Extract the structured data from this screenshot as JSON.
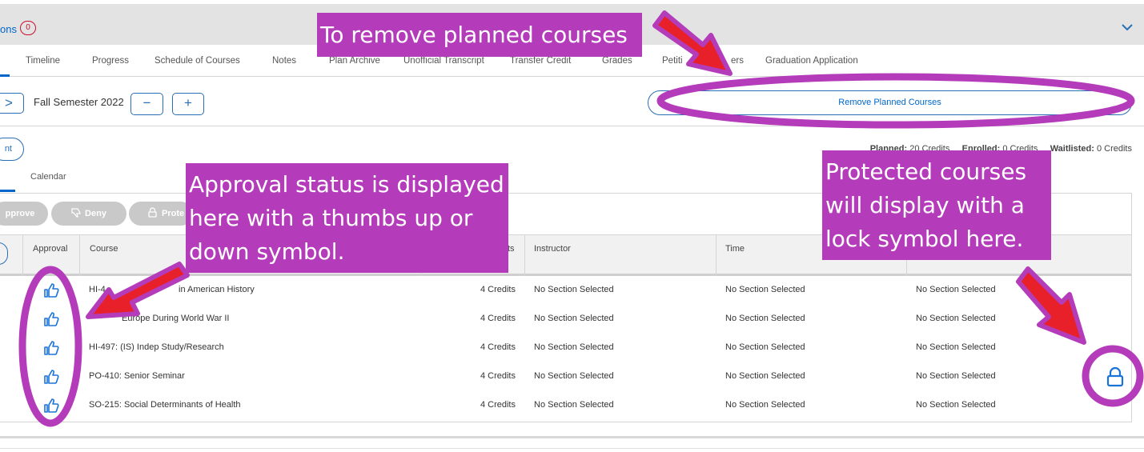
{
  "header": {
    "notifications_label": "ons",
    "notifications_count": "0"
  },
  "tabs": [
    "Timeline",
    "Progress",
    "Schedule of Courses",
    "Notes",
    "Plan Archive",
    "Unofficial Transcript",
    "Transfer Credit",
    "Grades",
    "Petiti",
    "ers",
    "Graduation Application"
  ],
  "term": {
    "label": "Fall Semester 2022",
    "next": ">",
    "minus": "−",
    "plus": "+"
  },
  "remove_button": "Remove Planned Courses",
  "left_pill": "nt",
  "credits": {
    "planned_label": "Planned:",
    "planned_value": "20 Credits",
    "enrolled_label": "Enrolled:",
    "enrolled_value": "0 Credits",
    "waitlisted_label": "Waitlisted:",
    "waitlisted_value": "0 Credits"
  },
  "subtab": "Calendar",
  "actions": {
    "approve": "pprove",
    "deny": "Deny",
    "protect": "Prote"
  },
  "columns": {
    "approval": "Approval",
    "course": "Course",
    "credits": "ts",
    "instructor": "Instructor",
    "time": "Time"
  },
  "rows": [
    {
      "course": "HI-4",
      "course_tail": "in American History",
      "credits": "4 Credits",
      "instructor": "No Section Selected",
      "time": "No Section Selected",
      "location": "No Section Selected"
    },
    {
      "course": "",
      "course_tail": "Europe During World War II",
      "credits": "4 Credits",
      "instructor": "No Section Selected",
      "time": "No Section Selected",
      "location": "No Section Selected"
    },
    {
      "course": "HI-497: (IS) Indep Study/Research",
      "course_tail": "",
      "credits": "4 Credits",
      "instructor": "No Section Selected",
      "time": "No Section Selected",
      "location": "No Section Selected"
    },
    {
      "course": "PO-410: Senior Seminar",
      "course_tail": "",
      "credits": "4 Credits",
      "instructor": "No Section Selected",
      "time": "No Section Selected",
      "location": "No Section Selected"
    },
    {
      "course": "SO-215: Social Determinants of Health",
      "course_tail": "",
      "credits": "4 Credits",
      "instructor": "No Section Selected",
      "time": "No Section Selected",
      "location": "No Section Selected"
    }
  ],
  "annotations": {
    "top": "To remove planned courses",
    "mid": "Approval status is displayed here with a thumbs up or down symbol.",
    "right": "Protected courses will display with a lock symbol here."
  },
  "colors": {
    "accent": "#0066cc",
    "annotation": "#b43cba",
    "arrow": "#e8202a"
  },
  "icons": {
    "thumbs": "thumbs-up-icon",
    "lock": "lock-icon",
    "chevron": "chevron-down-icon"
  }
}
